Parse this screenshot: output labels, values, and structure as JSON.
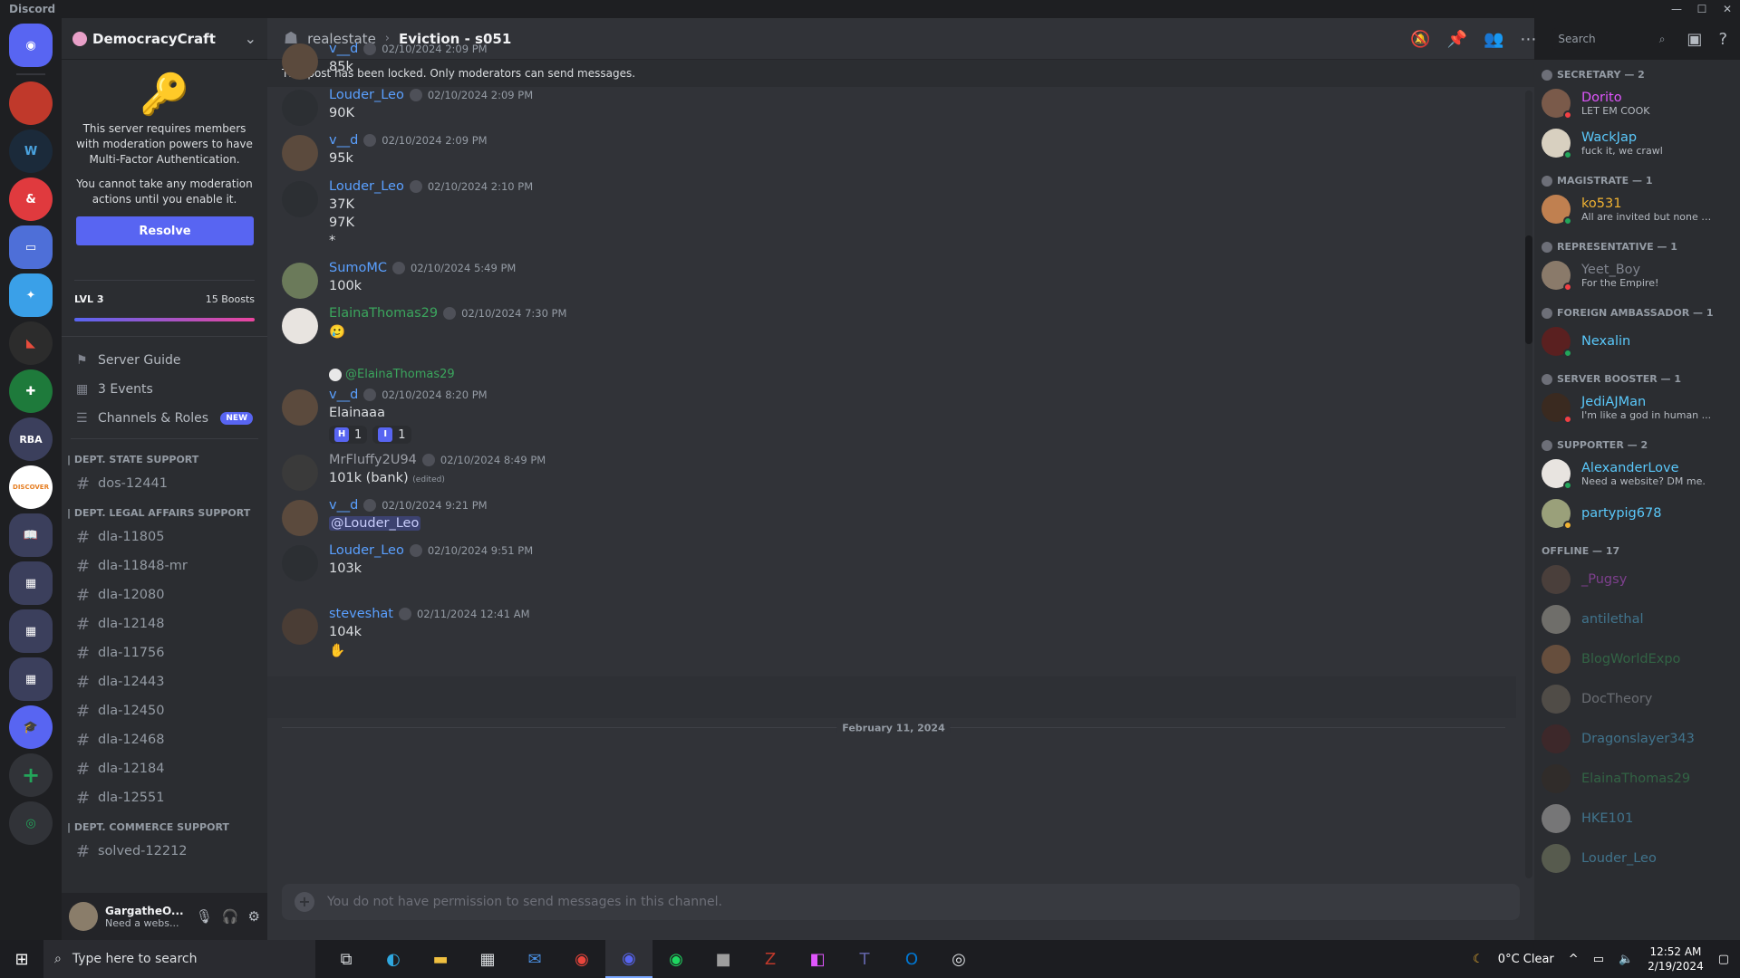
{
  "window": {
    "title": "Discord"
  },
  "server": {
    "name": "DemocracyCraft"
  },
  "mfa": {
    "text1": "This server requires members with moderation powers to have Multi-Factor Authentication.",
    "text2": "You cannot take any moderation actions until you enable it.",
    "resolve": "Resolve"
  },
  "boost": {
    "level": "LVL 3",
    "boosts": "15 Boosts",
    "fill": 1.0
  },
  "nav": {
    "guide": "Server Guide",
    "events": "3 Events",
    "roles": "Channels & Roles",
    "new_badge": "NEW"
  },
  "categories": [
    {
      "name": "| DEPT. STATE SUPPORT",
      "channels": [
        "dos-12441"
      ]
    },
    {
      "name": "| DEPT. LEGAL AFFAIRS SUPPORT",
      "channels": [
        "dla-11805",
        "dla-11848-mr",
        "dla-12080",
        "dla-12148",
        "dla-11756",
        "dla-12443",
        "dla-12450",
        "dla-12468",
        "dla-12184",
        "dla-12551"
      ]
    },
    {
      "name": "| DEPT. COMMERCE SUPPORT",
      "channels": [
        "solved-12212"
      ]
    }
  ],
  "user": {
    "name": "GargatheO...",
    "status": "Need a webs..."
  },
  "header": {
    "parent": "realestate",
    "post": "Eviction - s051",
    "search_placeholder": "Search"
  },
  "locked_notice": "This post has been locked. Only moderators can send messages.",
  "messages": [
    {
      "author": "v__d",
      "color": "#5aa0ff",
      "time": "02/10/2024 2:09 PM",
      "lines": [
        "85k"
      ]
    },
    {
      "author": "Louder_Leo",
      "color": "#5aa0ff",
      "time": "02/10/2024 2:09 PM",
      "lines": [
        "90K"
      ]
    },
    {
      "author": "v__d",
      "color": "#5aa0ff",
      "time": "02/10/2024 2:09 PM",
      "lines": [
        "95k"
      ]
    },
    {
      "author": "Louder_Leo",
      "color": "#5aa0ff",
      "time": "02/10/2024 2:10 PM",
      "lines": [
        "37K",
        "97K",
        "*"
      ]
    },
    {
      "author": "SumoMC",
      "color": "#5aa0ff",
      "time": "02/10/2024 5:49 PM",
      "lines": [
        "100k"
      ]
    },
    {
      "author": "ElainaThomas29",
      "color": "#3ba55d",
      "time": "02/10/2024 7:30 PM",
      "lines": [
        "🥲"
      ]
    },
    {
      "author": "v__d",
      "color": "#5aa0ff",
      "time": "02/10/2024 8:20 PM",
      "reply_to": "@ElainaThomas29",
      "lines": [
        "Elainaaa"
      ],
      "reactions": [
        {
          "label": "H",
          "count": "1"
        },
        {
          "label": "I",
          "count": "1"
        }
      ]
    },
    {
      "author": "MrFluffy2U94",
      "color": "#9b9ea6",
      "time": "02/10/2024 8:49 PM",
      "lines": [
        "101k (bank)"
      ],
      "edited": "(edited)"
    },
    {
      "author": "v__d",
      "color": "#5aa0ff",
      "time": "02/10/2024 9:21 PM",
      "lines": [
        "@Louder_Leo"
      ]
    },
    {
      "author": "Louder_Leo",
      "color": "#5aa0ff",
      "time": "02/10/2024 9:51 PM",
      "lines": [
        "103k"
      ]
    },
    {
      "author": "steveshat",
      "color": "#5aa0ff",
      "time": "02/11/2024 12:41 AM",
      "lines": [
        "104k",
        "✋"
      ]
    }
  ],
  "date_separator": "February 11, 2024",
  "input_placeholder": "You do not have permission to send messages in this channel.",
  "member_groups": [
    {
      "role": "SECRETARY — 2",
      "members": [
        {
          "name": "Dorito",
          "color": "#e056fd",
          "status": "LET EM COOK",
          "dot": "#f23f43"
        },
        {
          "name": "WackJap",
          "color": "#5ac8fa",
          "status": "fuck it, we crawl",
          "dot": "#23a55a"
        }
      ]
    },
    {
      "role": "MAGISTRATE — 1",
      "members": [
        {
          "name": "ko531",
          "color": "#f0b232",
          "status": "All are invited but none ar...",
          "dot": "#23a55a"
        }
      ]
    },
    {
      "role": "REPRESENTATIVE — 1",
      "members": [
        {
          "name": "Yeet_Boy",
          "color": "#80848e",
          "status": "For the Empire!",
          "dot": "#f23f43"
        }
      ]
    },
    {
      "role": "FOREIGN AMBASSADOR — 1",
      "members": [
        {
          "name": "Nexalin",
          "color": "#5ac8fa",
          "status": "",
          "dot": "#23a55a"
        }
      ]
    },
    {
      "role": "SERVER BOOSTER — 1",
      "members": [
        {
          "name": "JediAJMan",
          "color": "#5ac8fa",
          "status": "I'm like a god in human ...",
          "dot": "#f23f43"
        }
      ]
    },
    {
      "role": "SUPPORTER — 2",
      "members": [
        {
          "name": "AlexanderLove",
          "color": "#5ac8fa",
          "status": "Need a website? DM me.",
          "dot": "#23a55a"
        },
        {
          "name": "partypig678",
          "color": "#5ac8fa",
          "status": "",
          "dot": "#f0b232"
        }
      ]
    },
    {
      "role": "OFFLINE — 17",
      "offline": true,
      "members": [
        {
          "name": "_Pugsy",
          "color": "#e056fd",
          "status": ""
        },
        {
          "name": "antilethal",
          "color": "#5ac8fa",
          "status": ""
        },
        {
          "name": "BlogWorldExpo",
          "color": "#3ba55d",
          "status": ""
        },
        {
          "name": "DocTheory",
          "color": "#b5bac1",
          "status": ""
        },
        {
          "name": "Dragonslayer343",
          "color": "#5ac8fa",
          "status": ""
        },
        {
          "name": "ElainaThomas29",
          "color": "#3ba55d",
          "status": ""
        },
        {
          "name": "HKE101",
          "color": "#5ac8fa",
          "status": ""
        },
        {
          "name": "Louder_Leo",
          "color": "#5ac8fa",
          "status": ""
        }
      ]
    }
  ],
  "taskbar": {
    "search_placeholder": "Type here to search",
    "weather": "0°C  Clear",
    "time": "12:52 AM",
    "date": "2/19/2024"
  }
}
